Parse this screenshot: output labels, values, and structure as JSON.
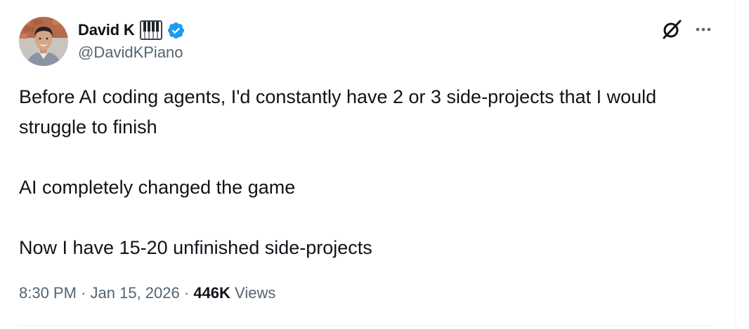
{
  "author": {
    "display_name": "David K",
    "handle": "@DavidKPiano",
    "name_emoji": "piano-keyboard-icon",
    "verified": true,
    "verified_color": "#1d9bf0",
    "avatar": "profile-photo"
  },
  "actions": {
    "grok_icon": "grok-icon",
    "more_icon": "more-horizontal-icon"
  },
  "tweet": {
    "paragraphs": [
      "Before AI coding agents, I'd constantly have 2 or 3 side-projects that I would struggle to finish",
      "AI completely changed the game",
      "Now I have 15-20 unfinished side-projects"
    ]
  },
  "meta": {
    "time": "8:30 PM",
    "separator": "·",
    "date": "Jan 15, 2026",
    "views_count": "446K",
    "views_label": "Views"
  },
  "colors": {
    "text_primary": "#0f1419",
    "text_secondary": "#536471",
    "divider": "#eff3f4"
  }
}
